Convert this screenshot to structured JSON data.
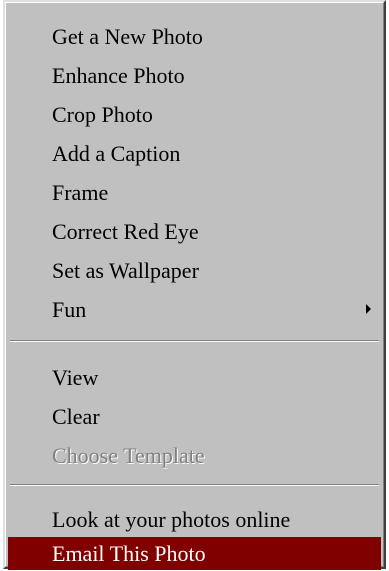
{
  "menu": {
    "groups": [
      {
        "items": [
          {
            "label": "Get a New Photo"
          },
          {
            "label": "Enhance Photo"
          },
          {
            "label": "Crop Photo"
          },
          {
            "label": "Add a Caption"
          },
          {
            "label": "Frame"
          },
          {
            "label": "Correct Red Eye"
          },
          {
            "label": "Set as Wallpaper"
          },
          {
            "label": "Fun",
            "has_submenu": true,
            "submenu_icon": "triangle-right-icon"
          }
        ]
      },
      {
        "items": [
          {
            "label": "View"
          },
          {
            "label": "Clear"
          },
          {
            "label": "Choose Template",
            "disabled": true
          }
        ]
      },
      {
        "items": [
          {
            "label": "Look at your photos online"
          },
          {
            "label": "Email This Photo",
            "highlighted": true
          }
        ]
      }
    ],
    "colors": {
      "background": "#c0c0c0",
      "highlight_bg": "#800000",
      "highlight_text": "#ffffff",
      "disabled_text": "#808080"
    }
  }
}
